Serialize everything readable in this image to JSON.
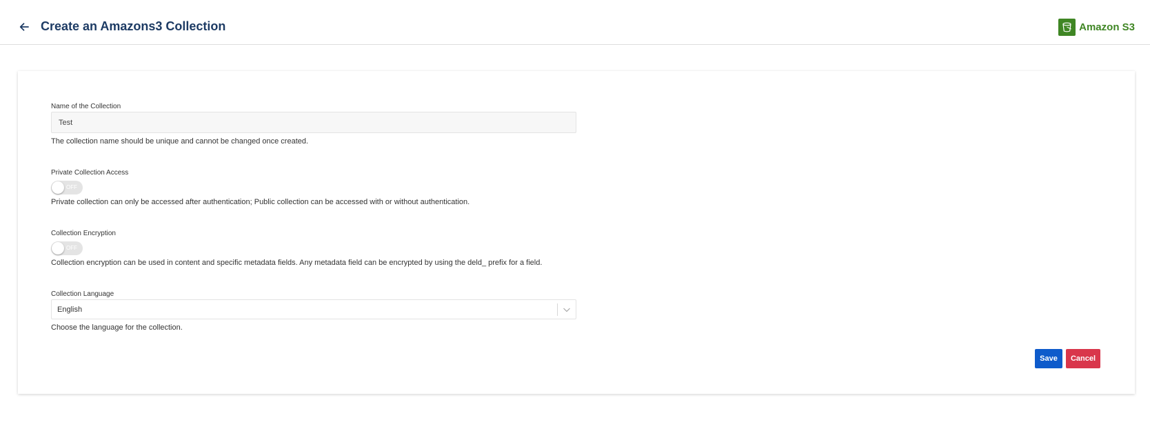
{
  "header": {
    "title": "Create an Amazons3 Collection",
    "back_icon": "arrow-left-icon",
    "brand_icon": "s3-bucket-icon",
    "brand_name": "Amazon S3",
    "brand_color": "#3f8624",
    "title_color": "#1d3b64"
  },
  "form": {
    "name": {
      "label": "Name of the Collection",
      "value": "Test",
      "help": "The collection name should be unique and cannot be changed once created."
    },
    "private_access": {
      "label": "Private Collection Access",
      "state": "OFF",
      "help": "Private collection can only be accessed after authentication; Public collection can be accessed with or without authentication."
    },
    "encryption": {
      "label": "Collection Encryption",
      "state": "OFF",
      "help": "Collection encryption can be used in content and specific metadata fields. Any metadata field can be encrypted by using the deld_ prefix for a field."
    },
    "language": {
      "label": "Collection Language",
      "value": "English",
      "help": "Choose the language for the collection."
    }
  },
  "actions": {
    "save_label": "Save",
    "cancel_label": "Cancel",
    "save_color": "#0e5bcb",
    "cancel_color": "#d9364b"
  }
}
